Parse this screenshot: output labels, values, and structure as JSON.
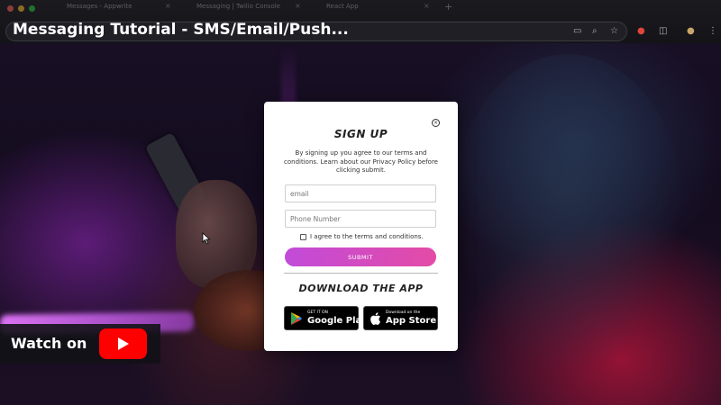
{
  "browser": {
    "tabs": [
      {
        "label": "Messages - Appwrite"
      },
      {
        "label": "Messaging | Twilio Console"
      },
      {
        "label": "React App"
      }
    ],
    "video_title": "Messaging Tutorial - SMS/Email/Push..."
  },
  "modal": {
    "title": "SIGN UP",
    "disclaimer": "By signing up you agree to our terms and conditions. Learn about our Privacy Policy before clicking submit.",
    "email_placeholder": "email",
    "phone_placeholder": "Phone Number",
    "agree_label": "I agree to the terms and conditions.",
    "submit_label": "SUBMIT",
    "download_title": "DOWNLOAD THE APP",
    "google_play": {
      "small": "GET IT ON",
      "big": "Google Play"
    },
    "app_store": {
      "small": "Download on the",
      "big": "App Store"
    }
  },
  "youtube": {
    "watch_label": "Watch on"
  },
  "colors": {
    "submit_gradient_start": "#c14bd9",
    "submit_gradient_end": "#e44ba6",
    "youtube_red": "#ff0000"
  }
}
